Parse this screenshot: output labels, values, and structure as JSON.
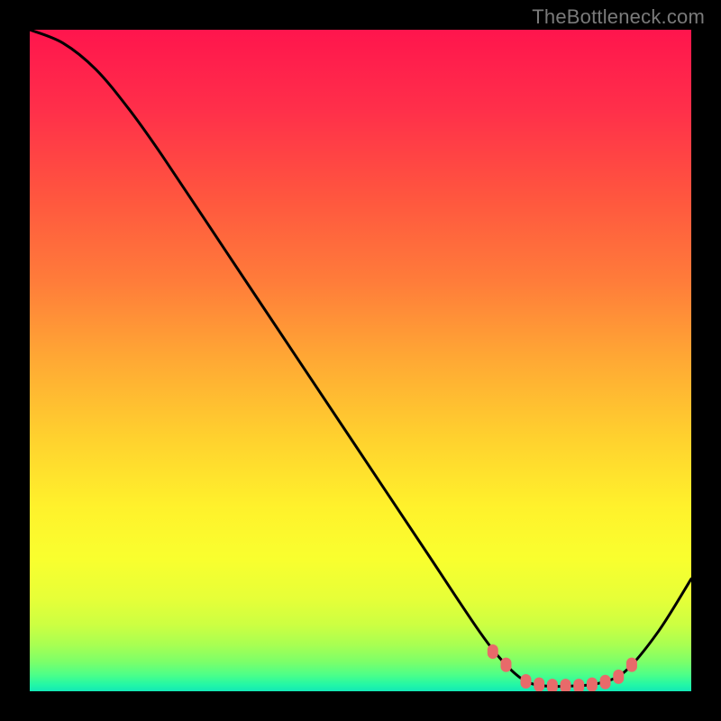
{
  "watermark": "TheBottleneck.com",
  "chart_data": {
    "type": "line",
    "title": "",
    "xlabel": "",
    "ylabel": "",
    "xlim": [
      0,
      100
    ],
    "ylim": [
      0,
      100
    ],
    "curve": [
      {
        "x": 0,
        "y": 100
      },
      {
        "x": 5,
        "y": 98
      },
      {
        "x": 10,
        "y": 94
      },
      {
        "x": 15,
        "y": 88
      },
      {
        "x": 20,
        "y": 81
      },
      {
        "x": 30,
        "y": 66
      },
      {
        "x": 40,
        "y": 51
      },
      {
        "x": 50,
        "y": 36
      },
      {
        "x": 60,
        "y": 21
      },
      {
        "x": 68,
        "y": 9
      },
      {
        "x": 72,
        "y": 4
      },
      {
        "x": 75,
        "y": 1.5
      },
      {
        "x": 78,
        "y": 0.8
      },
      {
        "x": 82,
        "y": 0.8
      },
      {
        "x": 86,
        "y": 1.2
      },
      {
        "x": 90,
        "y": 3
      },
      {
        "x": 95,
        "y": 9
      },
      {
        "x": 100,
        "y": 17
      }
    ],
    "markers": [
      {
        "x": 70,
        "y": 6
      },
      {
        "x": 72,
        "y": 4
      },
      {
        "x": 75,
        "y": 1.5
      },
      {
        "x": 77,
        "y": 1
      },
      {
        "x": 79,
        "y": 0.8
      },
      {
        "x": 81,
        "y": 0.8
      },
      {
        "x": 83,
        "y": 0.8
      },
      {
        "x": 85,
        "y": 1
      },
      {
        "x": 87,
        "y": 1.4
      },
      {
        "x": 89,
        "y": 2.2
      },
      {
        "x": 91,
        "y": 4
      }
    ],
    "gradient_stops": [
      {
        "offset": 0.0,
        "color": "#ff154d"
      },
      {
        "offset": 0.12,
        "color": "#ff2f4a"
      },
      {
        "offset": 0.25,
        "color": "#ff553f"
      },
      {
        "offset": 0.38,
        "color": "#ff7c3a"
      },
      {
        "offset": 0.5,
        "color": "#ffa934"
      },
      {
        "offset": 0.62,
        "color": "#ffd22e"
      },
      {
        "offset": 0.72,
        "color": "#fff12c"
      },
      {
        "offset": 0.8,
        "color": "#f9ff2e"
      },
      {
        "offset": 0.86,
        "color": "#e6ff38"
      },
      {
        "offset": 0.9,
        "color": "#ccff42"
      },
      {
        "offset": 0.93,
        "color": "#a8ff52"
      },
      {
        "offset": 0.955,
        "color": "#7dff69"
      },
      {
        "offset": 0.975,
        "color": "#4dff88"
      },
      {
        "offset": 0.99,
        "color": "#23f7a6"
      },
      {
        "offset": 1.0,
        "color": "#13e8b6"
      }
    ],
    "marker_color": "#e86a6a",
    "curve_color": "#000000"
  }
}
